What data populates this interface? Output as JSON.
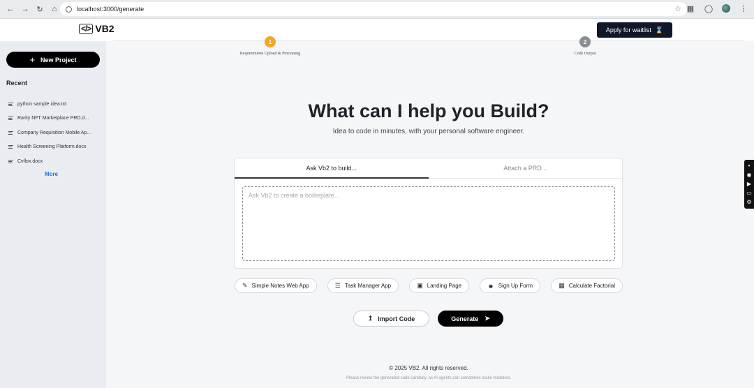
{
  "browser": {
    "url": "localhost:3000/generate"
  },
  "header": {
    "logo_text": "VB2",
    "waitlist_label": "Apply for waitlist"
  },
  "sidebar": {
    "new_project_label": "New Project",
    "recent_title": "Recent",
    "items": [
      {
        "label": "python sample idea.txt"
      },
      {
        "label": "Rarity NFT Marketplace PRD.d..."
      },
      {
        "label": "Company Requisition Mobile Ap..."
      },
      {
        "label": "Health Screening Platform.docx"
      },
      {
        "label": "Cvflox.docx"
      }
    ],
    "more_label": "More"
  },
  "stepper": {
    "steps": [
      {
        "number": "1",
        "label": "Requirements Upload & Processing",
        "color": "#f5a623"
      },
      {
        "number": "2",
        "label": "Code Output",
        "color": "#8a8d91"
      }
    ]
  },
  "hero": {
    "title": "What can I help you Build?",
    "subtitle": "Idea to code in minutes, with your personal software engineer."
  },
  "card": {
    "tabs": [
      {
        "label": "Ask Vb2 to build...",
        "active": true
      },
      {
        "label": "Attach a PRD...",
        "active": false
      }
    ],
    "prompt_placeholder": "Ask Vb2 to create a boilerplate...",
    "prompt_value": ""
  },
  "suggestions": [
    {
      "label": "Simple Notes Web App",
      "icon": "note-edit-icon"
    },
    {
      "label": "Task Manager App",
      "icon": "checklist-icon"
    },
    {
      "label": "Landing Page",
      "icon": "layout-icon"
    },
    {
      "label": "Sign Up Form",
      "icon": "user-plus-icon"
    },
    {
      "label": "Calculate Factorial",
      "icon": "calculator-icon"
    }
  ],
  "actions": {
    "import_label": "Import Code",
    "generate_label": "Generate"
  },
  "footer": {
    "copyright": "© 2025 VB2. All rights reserved.",
    "disclaimer": "Please review the generated code carefully, as AI agents can sometimes make mistakes."
  },
  "colors": {
    "primary_dark": "#0f1729",
    "accent_step": "#f5a623",
    "link": "#1a73e8",
    "sidebar_bg": "#e9edf2"
  }
}
